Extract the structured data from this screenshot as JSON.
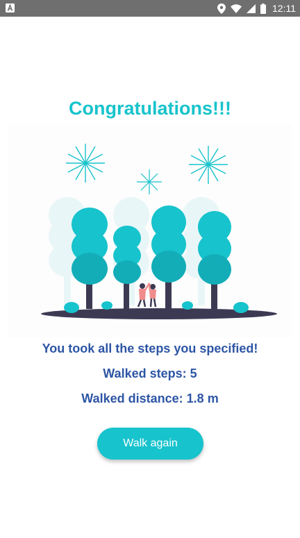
{
  "status_bar": {
    "time": "12:11",
    "icons": [
      "app-notification-icon",
      "location-icon",
      "wifi-icon",
      "signal-icon",
      "battery-icon"
    ]
  },
  "title": "Congratulations!!!",
  "illustration": {
    "name": "celebration-park-illustration"
  },
  "messages": {
    "steps_done": "You took all the steps you specified!",
    "walked_steps": "Walked steps: 5",
    "walked_distance": "Walked distance: 1.8 m"
  },
  "button": {
    "label": "Walk again"
  },
  "colors": {
    "accent": "#17c3cc",
    "text_primary": "#2d55a5",
    "status_bar": "#6f6f6f"
  }
}
